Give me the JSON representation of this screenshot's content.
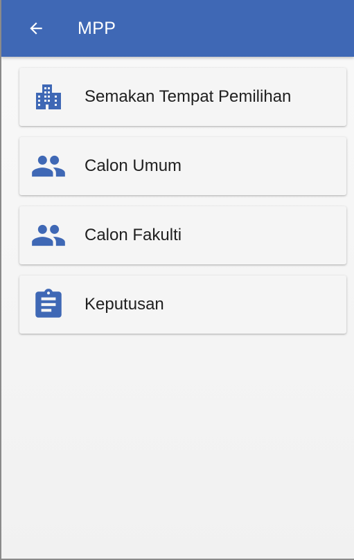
{
  "appbar": {
    "title": "MPP",
    "back_icon": "arrow-left-icon",
    "color": "#3f68b5"
  },
  "accent_color": "#3f68b5",
  "menu": {
    "items": [
      {
        "label": "Semakan Tempat Pemilihan",
        "icon": "building-icon"
      },
      {
        "label": "Calon Umum",
        "icon": "people-icon"
      },
      {
        "label": "Calon Fakulti",
        "icon": "people-icon"
      },
      {
        "label": "Keputusan",
        "icon": "clipboard-icon"
      }
    ]
  }
}
